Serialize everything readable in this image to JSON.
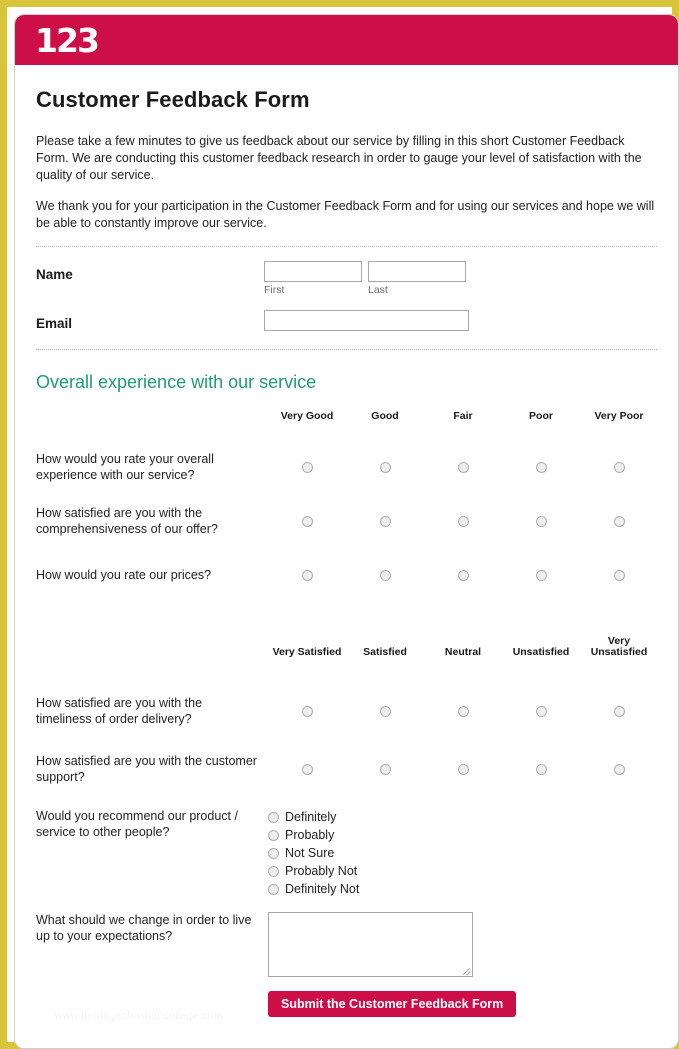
{
  "brand": {
    "logo_text": "123",
    "banner_color": "#ce0e47",
    "frame_color": "#d9c53c",
    "section_title_color": "#219b72"
  },
  "form": {
    "title": "Customer Feedback Form",
    "intro": {
      "paragraph1": "Please take a few minutes to give us feedback about our service by filling in this short Customer Feedback Form.  We are conducting this customer feedback research in order to gauge your level of satisfaction with the quality of our service.",
      "paragraph2": "We thank you for your participation in the Customer Feedback Form and for using our services and hope we will be able to constantly improve our service."
    },
    "name_field": {
      "label": "Name",
      "first_value": "",
      "first_sublabel": "First",
      "last_value": "",
      "last_sublabel": "Last"
    },
    "email_field": {
      "label": "Email",
      "value": ""
    },
    "section_title": "Overall experience with our service",
    "matrix1": {
      "columns": [
        "Very Good",
        "Good",
        "Fair",
        "Poor",
        "Very Poor"
      ],
      "questions": [
        "How would you rate your overall experience with our service?",
        "How satisfied are you with the comprehensiveness of our offer?",
        "How would you rate our prices?"
      ]
    },
    "matrix2": {
      "columns": [
        "Very Satisfied",
        "Satisfied",
        "Neutral",
        "Unsatisfied",
        "Very Unsatisfied"
      ],
      "questions": [
        "How satisfied are you with the timeliness of order delivery?",
        "How satisfied are you with the customer support?"
      ]
    },
    "recommend_question": {
      "label": "Would you recommend our product / service to other people?",
      "options": [
        "Definitely",
        "Probably",
        "Not Sure",
        "Probably Not",
        "Definitely Not"
      ]
    },
    "change_question": {
      "label": "What should we change in order to live up to your expectations?",
      "value": ""
    },
    "submit_label": "Submit the Customer Feedback Form"
  },
  "watermark": "www.heritagechristiancollege.com"
}
